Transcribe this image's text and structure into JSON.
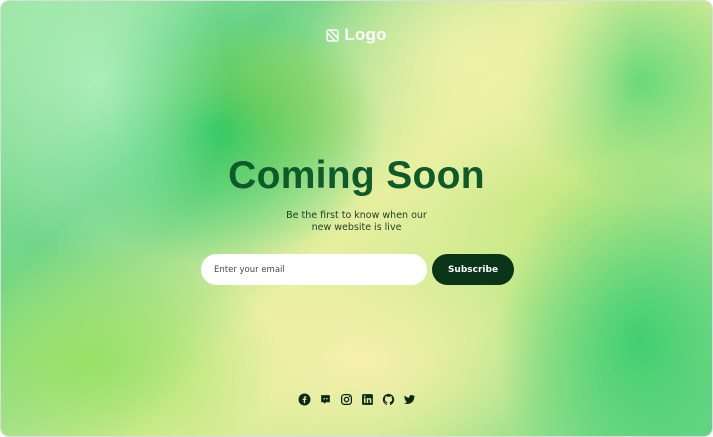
{
  "header": {
    "logo_text": "Logo",
    "logo_icon": "slashed-square-icon"
  },
  "main": {
    "title": "Coming Soon",
    "subtitle_line1": "Be the first to know when our",
    "subtitle_line2": "new website is live",
    "email_placeholder": "Enter your email",
    "email_value": "",
    "subscribe_label": "Subscribe"
  },
  "footer": {
    "social_icons": [
      "facebook-icon",
      "discord-icon",
      "instagram-icon",
      "linkedin-icon",
      "github-icon",
      "twitter-icon"
    ]
  },
  "colors": {
    "title": "#0f5a2a",
    "button_bg": "#0b3518",
    "button_text": "#ffffff",
    "icon": "#0b2a14"
  }
}
